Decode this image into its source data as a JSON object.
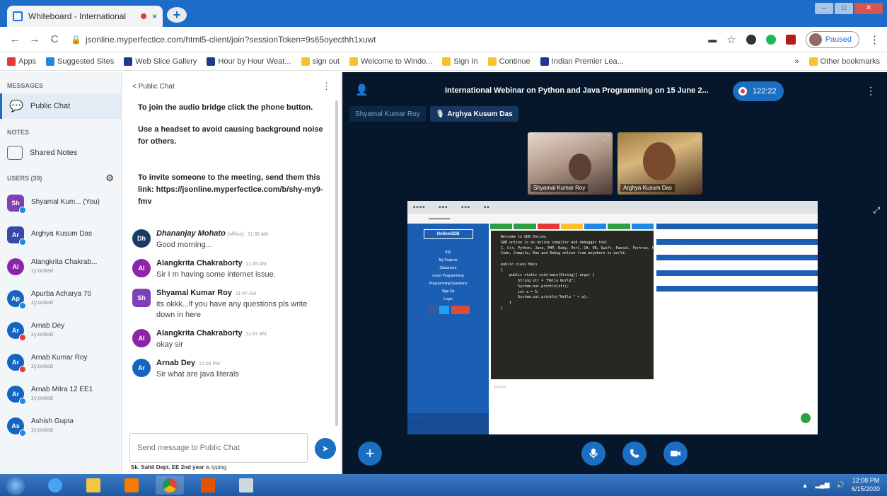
{
  "browser": {
    "tab_title": "Whiteboard - International",
    "tab_close": "×",
    "new_tab": "+",
    "back": "←",
    "forward": "→",
    "reload": "C",
    "url": "jsonline.myperfectice.com/html5-client/join?sessionToken=9s65oyecthh1xuwt",
    "profile_status": "Paused",
    "menu": "⋮"
  },
  "bookmarks": {
    "apps": "Apps",
    "items": [
      "Suggested Sites",
      "Web Slice Gallery",
      "Hour by Hour Weat...",
      "sign out",
      "Welcome to Windo...",
      "Sign In",
      "Continue",
      "Indian Premier Lea..."
    ],
    "more": "»",
    "other": "Other bookmarks"
  },
  "sidebar": {
    "messages_label": "MESSAGES",
    "public_chat": "Public Chat",
    "notes_label": "NOTES",
    "shared_notes": "Shared Notes",
    "users_label": "USERS (39)",
    "users": [
      {
        "initials": "Sh",
        "name": "Shyamal Kum... (You)",
        "status": "",
        "color": "#7e3fb8",
        "badge": "#1e88e5",
        "shape": "sq"
      },
      {
        "initials": "Ar",
        "name": "Arghya Kusum Das",
        "status": "",
        "color": "#3949ab",
        "badge": "#1e88e5",
        "shape": "sq"
      },
      {
        "initials": "Al",
        "name": "Alangkrita Chakrab...",
        "status": "zy.ocked",
        "color": "#8e24aa",
        "badge": "",
        "shape": "round"
      },
      {
        "initials": "Ap",
        "name": "Apurba Acharya 70",
        "status": "zy.ocked",
        "color": "#1565c0",
        "badge": "#1e88e5",
        "shape": "round"
      },
      {
        "initials": "Ar",
        "name": "Arnab Dey",
        "status": "zy.ocked",
        "color": "#1565c0",
        "badge": "#e53935",
        "shape": "round"
      },
      {
        "initials": "Ar",
        "name": "Arnab Kumar Roy",
        "status": "zy.ocked",
        "color": "#1565c0",
        "badge": "#e53935",
        "shape": "round"
      },
      {
        "initials": "Ar",
        "name": "Arnab Mitra 12 EE1",
        "status": "zy.ocked",
        "color": "#1565c0",
        "badge": "#1e88e5",
        "shape": "round"
      },
      {
        "initials": "As",
        "name": "Ashish Gupta",
        "status": "zy.ocked",
        "color": "#1565c0",
        "badge": "#1e88e5",
        "shape": "round"
      }
    ]
  },
  "chat": {
    "back_label": "< Public Chat",
    "system": [
      "To join the audio bridge click the phone button.",
      "Use a headset to avoid causing background noise for others.",
      "To invite someone to the meeting, send them this link: https://jsonline.myperfectice.com/b/shy-my9-fmv"
    ],
    "messages": [
      {
        "initials": "Dh",
        "name": "Dhananjay Mohato",
        "role": "(offline)",
        "time": "11:39 AM",
        "text": "Good morning...",
        "color": "#1a3a66",
        "shape": "round",
        "italic": true
      },
      {
        "initials": "Al",
        "name": "Alangkrita Chakraborty",
        "role": "",
        "time": "11:45 AM",
        "text": "Sir I m having some internet issue.",
        "color": "#8e24aa",
        "shape": "round",
        "italic": false
      },
      {
        "initials": "Sh",
        "name": "Shyamal Kumar Roy",
        "role": "",
        "time": "11:47 AM",
        "text": "its okkk...if you have any questions pls write down in here",
        "color": "#7e3fb8",
        "shape": "sq",
        "italic": false
      },
      {
        "initials": "Al",
        "name": "Alangkrita Chakraborty",
        "role": "",
        "time": "11:47 AM",
        "text": "okay sir",
        "color": "#8e24aa",
        "shape": "round",
        "italic": false
      },
      {
        "initials": "Ar",
        "name": "Arnab Dey",
        "role": "",
        "time": "12:06 PM",
        "text": "Sir what are java literals",
        "color": "#1565c0",
        "shape": "round",
        "italic": false
      }
    ],
    "input_placeholder": "Send message to Public Chat",
    "typing_name": "Sk. Sahil Dept. EE 2nd year",
    "typing_suffix": " is typing"
  },
  "stage": {
    "title": "International Webinar on Python and Java Programming on 15 June 2...",
    "record_time": "122:22",
    "talkers": [
      "Shyamal Kumar Roy",
      "Arghya Kusum Das"
    ],
    "cams": [
      "Shyamal Kumar Roy",
      "Arghya Kusum Das"
    ]
  },
  "shared_screen": {
    "logo": "OnlineGDB",
    "side_items": [
      "IDE",
      "My Projects",
      "Classroom",
      "Learn Programming",
      "Programming Questions",
      "Sign Up",
      "Login"
    ],
    "code": "Welcome to GDB Online.\nGDB online is an online compiler and debugger tool\nC, C++, Python, Java, PHP, Ruby, Perl, C#, VB, Swift, Pascal, Fortran, Haskell, Objective-C\nCode, Compile, Run and Debug online from anywhere in world.\n\npublic class Main\n{\n    public static void main(String[] args) {\n        String str = \"Hello World\";\n        System.out.println(str);\n        int a = 5;\n        System.out.println(\"Hello \" + a);\n    }\n}"
  },
  "taskbar": {
    "time": "12:08 PM",
    "date": "6/15/2020"
  },
  "colors": {
    "accent": "#1b6ec2",
    "stage_bg": "#06172b",
    "chrome_blue": "#1d6cc7"
  }
}
